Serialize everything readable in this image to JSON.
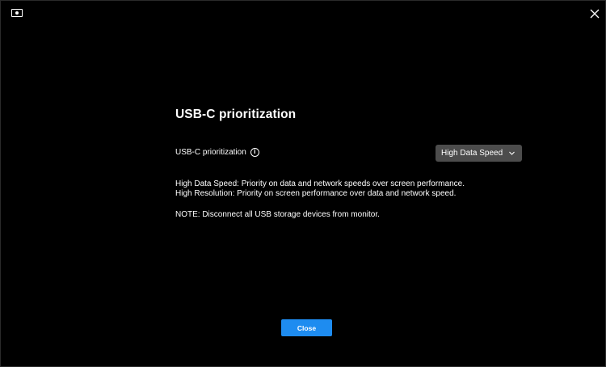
{
  "window": {
    "app_icon": "monitor-icon",
    "close_icon": "close-icon"
  },
  "main": {
    "title": "USB-C prioritization",
    "setting_label": "USB-C prioritization",
    "info_icon": "info-icon",
    "info_glyph": "i",
    "dropdown": {
      "selected": "High Data Speed",
      "icon": "chevron-down-icon"
    },
    "descriptions": [
      "High Data Speed: Priority on data and network speeds over screen performance.",
      "High Resolution:  Priority on screen performance over data and network speed."
    ],
    "note": "NOTE: Disconnect all USB storage devices from monitor."
  },
  "footer": {
    "close_label": "Close"
  },
  "colors": {
    "background": "#000000",
    "accent": "#1e8cf0",
    "dropdown_bg": "#4c4c4c",
    "text": "#ffffff"
  }
}
